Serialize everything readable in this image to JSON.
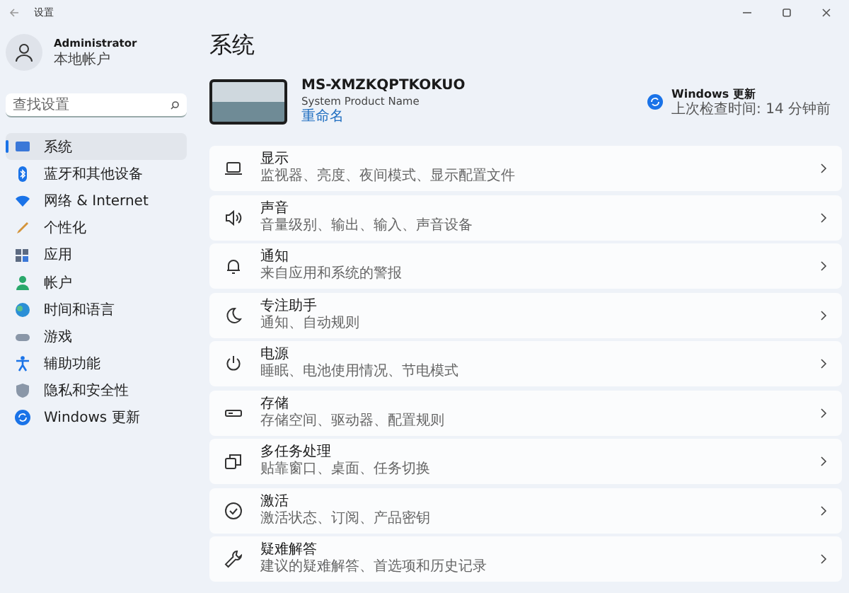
{
  "window": {
    "title": "设置"
  },
  "account": {
    "name": "Administrator",
    "type": "本地帐户"
  },
  "search": {
    "placeholder": "查找设置"
  },
  "sidebar": {
    "items": [
      {
        "label": "系统",
        "selected": true
      },
      {
        "label": "蓝牙和其他设备",
        "selected": false
      },
      {
        "label": "网络 & Internet",
        "selected": false
      },
      {
        "label": "个性化",
        "selected": false
      },
      {
        "label": "应用",
        "selected": false
      },
      {
        "label": "帐户",
        "selected": false
      },
      {
        "label": "时间和语言",
        "selected": false
      },
      {
        "label": "游戏",
        "selected": false
      },
      {
        "label": "辅助功能",
        "selected": false
      },
      {
        "label": "隐私和安全性",
        "selected": false
      },
      {
        "label": "Windows 更新",
        "selected": false
      }
    ]
  },
  "page": {
    "title": "系统"
  },
  "device": {
    "name": "MS-XMZKQPTKOKUO",
    "model": "System Product Name",
    "rename_link": "重命名"
  },
  "update": {
    "title": "Windows 更新",
    "status": "上次检查时间: 14 分钟前"
  },
  "settings": [
    {
      "title": "显示",
      "subtitle": "监视器、亮度、夜间模式、显示配置文件"
    },
    {
      "title": "声音",
      "subtitle": "音量级别、输出、输入、声音设备"
    },
    {
      "title": "通知",
      "subtitle": "来自应用和系统的警报"
    },
    {
      "title": "专注助手",
      "subtitle": "通知、自动规则"
    },
    {
      "title": "电源",
      "subtitle": "睡眠、电池使用情况、节电模式"
    },
    {
      "title": "存储",
      "subtitle": "存储空间、驱动器、配置规则"
    },
    {
      "title": "多任务处理",
      "subtitle": "贴靠窗口、桌面、任务切换"
    },
    {
      "title": "激活",
      "subtitle": "激活状态、订阅、产品密钥"
    },
    {
      "title": "疑难解答",
      "subtitle": "建议的疑难解答、首选项和历史记录"
    }
  ]
}
